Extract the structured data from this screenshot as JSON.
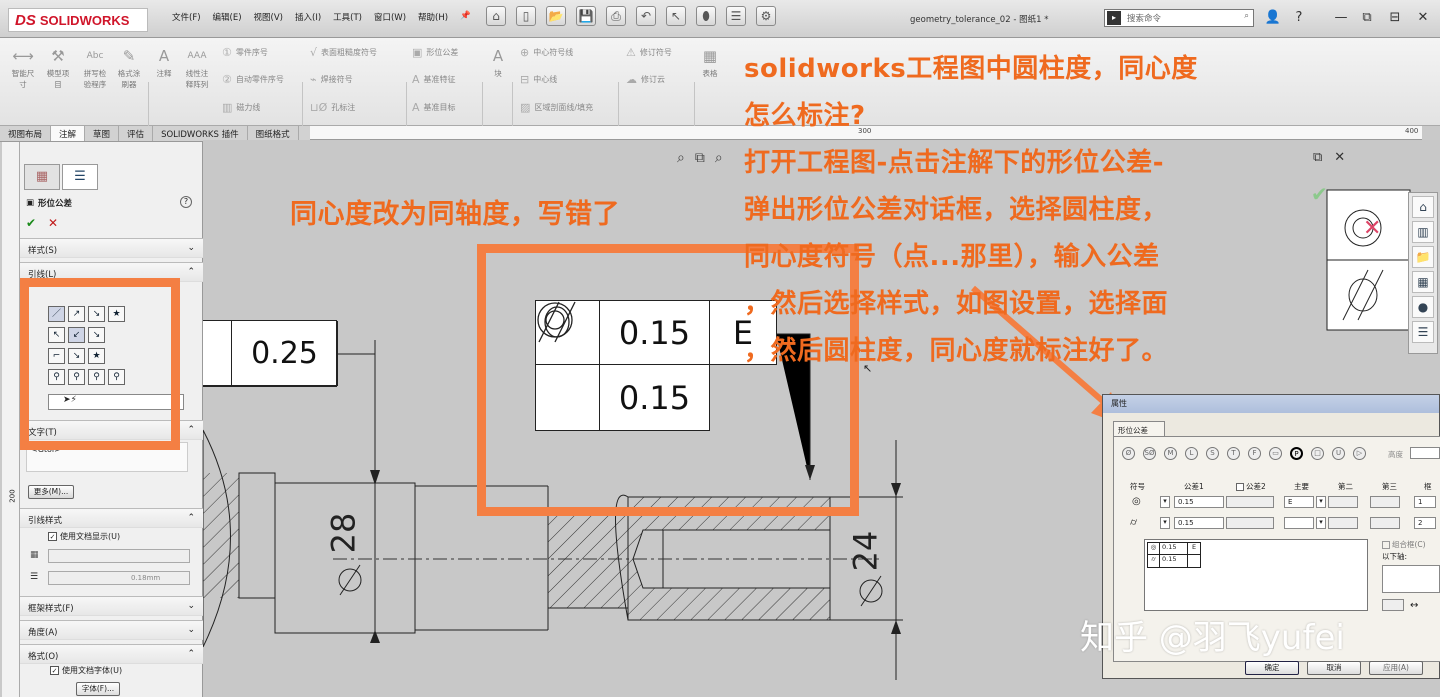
{
  "app": {
    "logo_text": "SOLIDWORKS",
    "logo_mark": "DS",
    "doc_title": "geometry_tolerance_02 - 图纸1 *",
    "search_placeholder": "搜索命令"
  },
  "menu": [
    "文件(F)",
    "编辑(E)",
    "视图(V)",
    "插入(I)",
    "工具(T)",
    "窗口(W)",
    "帮助(H)"
  ],
  "ribbon": {
    "big": [
      {
        "label": "智能尺\n寸",
        "icon": "⟷"
      },
      {
        "label": "模型项\n目",
        "icon": "⚒"
      },
      {
        "label": "拼写检\n验程序",
        "icon": "Abc"
      },
      {
        "label": "格式涂\n刷器",
        "icon": "✎"
      },
      {
        "label": "注释",
        "icon": "A"
      },
      {
        "label": "线性注\n释阵列",
        "icon": "AAA"
      },
      {
        "label": "块",
        "icon": "A"
      },
      {
        "label": "表格",
        "icon": "▦"
      }
    ],
    "small": [
      {
        "label": "零件序号",
        "icon": "①"
      },
      {
        "label": "自动零件序号",
        "icon": "②"
      },
      {
        "label": "磁力线",
        "icon": "▥"
      },
      {
        "label": "表面粗糙度符号",
        "icon": "√"
      },
      {
        "label": "焊接符号",
        "icon": "⌁"
      },
      {
        "label": "孔标注",
        "icon": "⊔Ø"
      },
      {
        "label": "形位公差",
        "icon": "▣"
      },
      {
        "label": "基准特征",
        "icon": "A"
      },
      {
        "label": "基准目标",
        "icon": "A"
      },
      {
        "label": "中心符号线",
        "icon": "⊕"
      },
      {
        "label": "中心线",
        "icon": "⊟"
      },
      {
        "label": "区域剖面线/填充",
        "icon": "▨"
      },
      {
        "label": "修订符号",
        "icon": "⚠"
      },
      {
        "label": "修订云",
        "icon": "☁"
      }
    ]
  },
  "tabs": [
    "视图布局",
    "注解",
    "草图",
    "评估",
    "SOLIDWORKS 插件",
    "图纸格式"
  ],
  "ruler": {
    "marks": [
      "300",
      "400"
    ]
  },
  "vruler_label": "200",
  "panel": {
    "title": "形位公差",
    "sections": {
      "style": "样式(S)",
      "leader": "引线(L)",
      "text": "文字(T)",
      "text_value": "<Gtol>",
      "more_button": "更多(M)...",
      "leader_style": "引线样式",
      "use_doc_display": "使用文档显示(U)",
      "line_thickness": "0.18mm",
      "frame_style": "框架样式(F)",
      "angle": "角度(A)",
      "format": "格式(O)",
      "use_doc_font": "使用文档字体(U)",
      "font_button": "字体(F)..."
    },
    "leader_tools": [
      [
        "／",
        "↗",
        "↘",
        "★"
      ],
      [
        "↖",
        "↙",
        "↘",
        ""
      ],
      [
        "⌐",
        "↘",
        "★",
        ""
      ],
      [
        "⚲",
        "⚲",
        "⚲",
        "⚲"
      ]
    ]
  },
  "drawing": {
    "fcf_main": {
      "tol1": "0.15",
      "datum": "E",
      "tol2": "0.15"
    },
    "fcf_left": {
      "tol": "0.25"
    },
    "dims": {
      "d28": "28",
      "d24": "24"
    },
    "overlay_label": "同心度改为同轴度，写错了",
    "tutorial_lines": [
      "solidworks工程图中圆柱度，同心度",
      "怎么标注?",
      "打开工程图-点击注解下的形位公差-",
      "弹出形位公差对话框，选择圆柱度，",
      "同心度符号（点...那里），输入公差",
      "，然后选择样式，如图设置，选择面",
      "，然后圆柱度，同心度就标注好了。"
    ],
    "accent_color": "#f47f43",
    "text_color": "#ef6a1f"
  },
  "properties": {
    "title": "属性",
    "tab": "形位公差",
    "height_label": "高度",
    "col_headers": [
      "符号",
      "公差1",
      "公差2",
      "主要",
      "第二",
      "第三",
      "框"
    ],
    "rows": [
      {
        "tol1": "0.15",
        "primary": "E",
        "frame": "1"
      },
      {
        "tol1": "0.15",
        "primary": "",
        "frame": "2"
      }
    ],
    "preview": [
      {
        "tol": "0.15",
        "datum": "E"
      },
      {
        "tol": "0.15",
        "datum": ""
      }
    ],
    "combine_frame": "组合框(C)",
    "below_label": "以下轴:",
    "ok": "确定",
    "cancel": "取消",
    "apply": "应用(A)",
    "symbol_buttons": [
      "Ø",
      "SØ",
      "M",
      "L",
      "S",
      "T",
      "F",
      "▭",
      "P",
      "□",
      "U",
      "▷"
    ]
  },
  "watermark": "知乎 @羽飞yufei"
}
